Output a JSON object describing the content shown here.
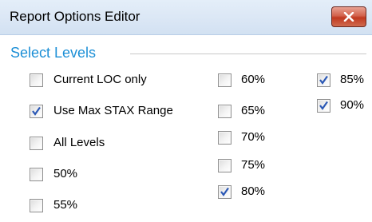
{
  "window": {
    "title": "Report Options Editor",
    "close_icon": "close-x-icon"
  },
  "group": {
    "title": "Select Levels"
  },
  "options": {
    "current_loc_only": {
      "label": "Current LOC only",
      "checked": false
    },
    "use_max_stax_range": {
      "label": "Use Max STAX Range",
      "checked": true
    },
    "all_levels": {
      "label": "All Levels",
      "checked": false
    },
    "level_50": {
      "label": "50%",
      "checked": false
    },
    "level_55": {
      "label": "55%",
      "checked": false
    },
    "level_60": {
      "label": "60%",
      "checked": false
    },
    "level_65": {
      "label": "65%",
      "checked": false
    },
    "level_70": {
      "label": "70%",
      "checked": false
    },
    "level_75": {
      "label": "75%",
      "checked": false
    },
    "level_80": {
      "label": "80%",
      "checked": true
    },
    "level_85": {
      "label": "85%",
      "checked": true
    },
    "level_90": {
      "label": "90%",
      "checked": true
    }
  },
  "colors": {
    "group_title": "#1c8fd6",
    "checkmark": "#2b58b5",
    "close_button": "#c7432a"
  }
}
